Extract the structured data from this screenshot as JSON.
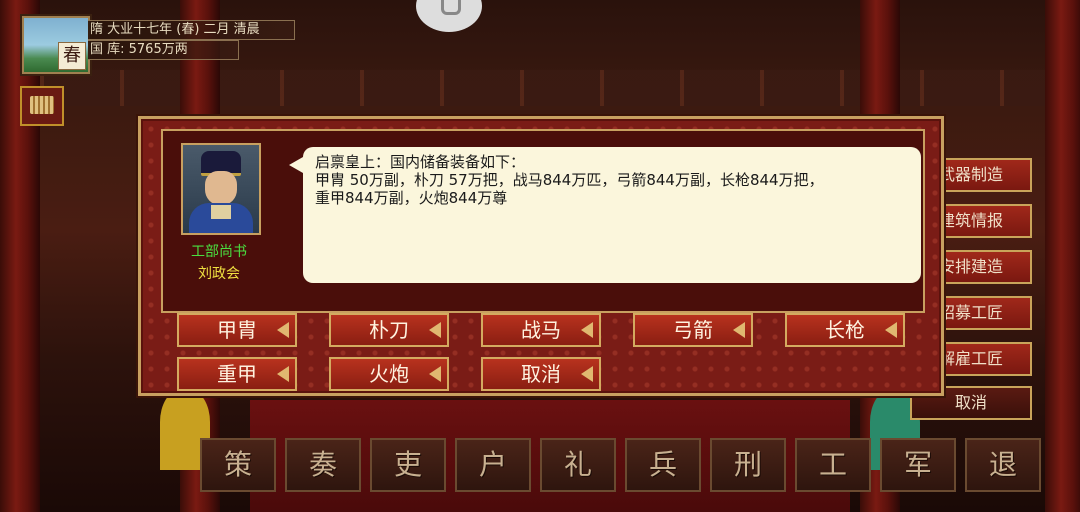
{
  "status": {
    "season_glyph": "春",
    "date": "隋 大业十七年 (春) 二月 清晨",
    "treasury": "国 库: 5765万两"
  },
  "dialog": {
    "speaker_title": "工部尚书",
    "speaker_name": "刘政会",
    "message_lines": [
      "启禀皇上：国内储备装备如下：",
      "甲胄 50万副，朴刀 57万把，战马844万匹，弓箭844万副，长枪844万把，",
      "重甲844万副，火炮844万尊"
    ],
    "choices": [
      "甲胄",
      "朴刀",
      "战马",
      "弓箭",
      "长枪",
      "重甲",
      "火炮",
      "取消"
    ]
  },
  "side_menu": [
    "武器制造",
    "建筑情报",
    "安排建造",
    "招募工匠",
    "解雇工匠",
    "取消"
  ],
  "bottom_menu": [
    "策",
    "奏",
    "吏",
    "户",
    "礼",
    "兵",
    "刑",
    "工",
    "军",
    "退"
  ]
}
